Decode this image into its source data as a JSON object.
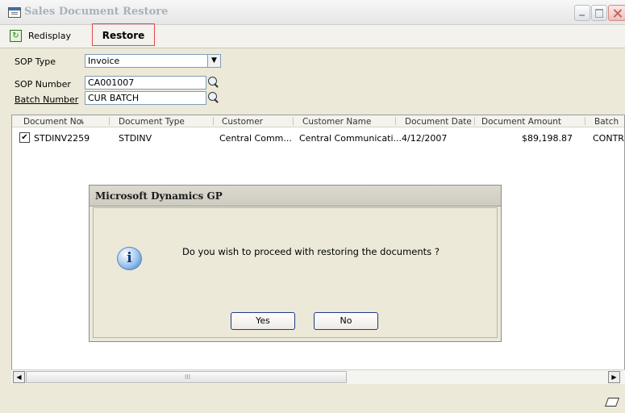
{
  "window": {
    "title": "Sales Document Restore"
  },
  "toolbar": {
    "redisplay_label": "Redisplay",
    "restore_label": "Restore"
  },
  "form": {
    "sop_type_label": "SOP Type",
    "sop_type_value": "Invoice",
    "sop_number_label": "SOP Number",
    "sop_number_value": "CA001007",
    "batch_number_label": "Batch Number",
    "batch_number_value": "CUR BATCH"
  },
  "grid": {
    "columns": [
      "Document No.",
      "Document Type",
      "Customer",
      "Customer Name",
      "Document Date",
      "Document Amount",
      "Batch"
    ],
    "rows": [
      {
        "checked": true,
        "document_no": "STDINV2259",
        "document_type": "STDINV",
        "customer": "Central Comm...",
        "customer_name": "Central Communicati...",
        "document_date": "4/12/2007",
        "document_amount": "$89,198.87",
        "batch": "CONTR"
      }
    ]
  },
  "dialog": {
    "title": "Microsoft Dynamics GP",
    "message": "Do you wish to proceed with restoring the documents ?",
    "yes_label": "Yes",
    "no_label": "No"
  },
  "scrollbar": {
    "grip": "III"
  }
}
